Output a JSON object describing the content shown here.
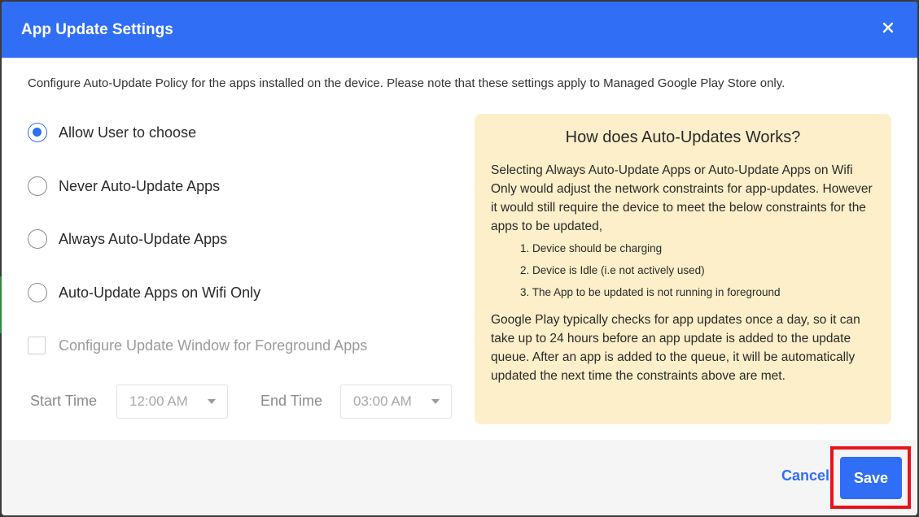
{
  "dialog": {
    "title": "App Update Settings",
    "description": "Configure Auto-Update Policy for the apps installed on the device. Please note that these settings apply to Managed Google Play Store only."
  },
  "options": [
    {
      "label": "Allow User to choose",
      "checked": true
    },
    {
      "label": "Never Auto-Update Apps",
      "checked": false
    },
    {
      "label": "Always Auto-Update Apps",
      "checked": false
    },
    {
      "label": "Auto-Update Apps on Wifi Only",
      "checked": false
    }
  ],
  "foreground": {
    "checkbox_label": "Configure Update Window for Foreground Apps",
    "start_label": "Start Time",
    "start_value": "12:00 AM",
    "end_label": "End Time",
    "end_value": "03:00 AM"
  },
  "info": {
    "title": "How does Auto-Updates Works?",
    "para1": "Selecting Always Auto-Update Apps or Auto-Update Apps on Wifi Only would adjust the network constraints for app-updates. However it would still require the device to meet the below constraints for the apps to be updated,",
    "list": [
      "1. Device should be charging",
      "2. Device is Idle (i.e not actively used)",
      "3. The App to be updated is not running in foreground"
    ],
    "para2": "Google Play typically checks for app updates once a day, so it can take up to 24 hours before an app update is added to the update queue. After an app is added to the queue, it will be automatically updated the next time the constraints above are met."
  },
  "footer": {
    "cancel_label": "Cancel",
    "save_label": "Save"
  },
  "colors": {
    "accent": "#2f6ef5",
    "info_bg": "#fcefc9",
    "highlight": "#e8141c"
  }
}
